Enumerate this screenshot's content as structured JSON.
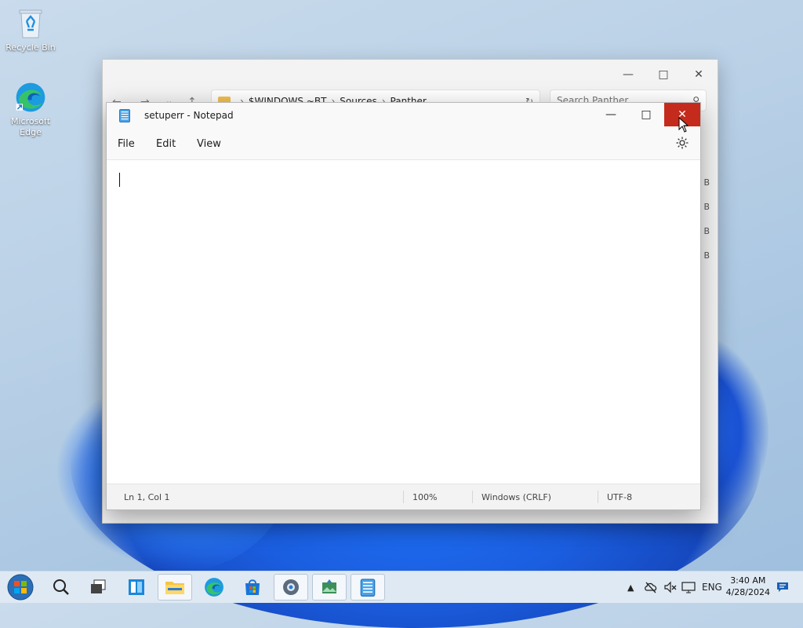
{
  "desktop": {
    "icons": [
      {
        "label": "Recycle Bin"
      },
      {
        "label": "Microsoft Edge"
      }
    ]
  },
  "explorer": {
    "breadcrumb": [
      "$WINDOWS.~BT",
      "Sources",
      "Panther"
    ],
    "search_placeholder": "Search Panther",
    "size_suffix": "B"
  },
  "notepad": {
    "title": "setuperr - Notepad",
    "menu": [
      "File",
      "Edit",
      "View"
    ],
    "content": "",
    "status": {
      "position": "Ln 1, Col 1",
      "zoom": "100%",
      "line_ending": "Windows (CRLF)",
      "encoding": "UTF-8"
    }
  },
  "taskbar": {
    "language": "ENG",
    "time": "3:40 AM",
    "date": "4/28/2024"
  },
  "colors": {
    "close_hover": "#c42b1c",
    "accent": "#0067c0"
  }
}
